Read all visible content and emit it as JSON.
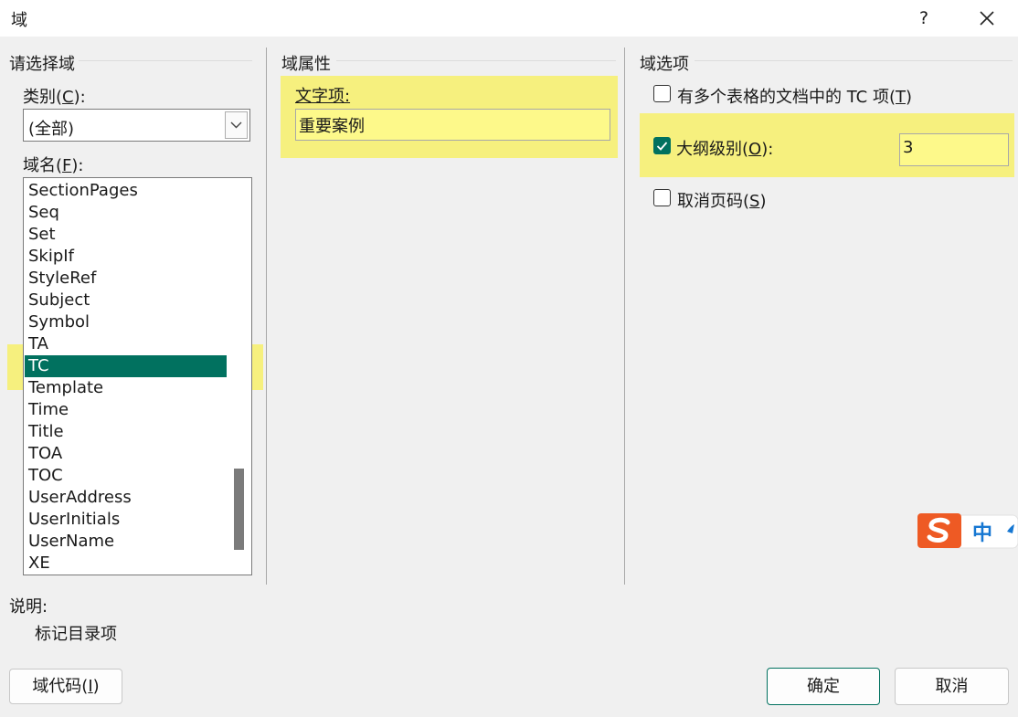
{
  "window": {
    "title": "域",
    "help": "?"
  },
  "left": {
    "group_title": "请选择域",
    "category": {
      "label_pre": "类别(",
      "label_key": "C",
      "label_post": "):",
      "value": "(全部)"
    },
    "fieldnames": {
      "label_pre": "域名(",
      "label_key": "F",
      "label_post": "):",
      "items": [
        "SectionPages",
        "Seq",
        "Set",
        "SkipIf",
        "StyleRef",
        "Subject",
        "Symbol",
        "TA",
        "TC",
        "Template",
        "Time",
        "Title",
        "TOA",
        "TOC",
        "UserAddress",
        "UserInitials",
        "UserName",
        "XE"
      ],
      "selected": "TC"
    }
  },
  "middle": {
    "group_title": "域属性",
    "text_entry": {
      "label": "文字项:",
      "value": "重要案例"
    }
  },
  "right": {
    "group_title": "域选项",
    "opt_multi_table": {
      "label_pre": "有多个表格的文档中的 TC 项(",
      "label_key": "T",
      "label_post": ")",
      "checked": false
    },
    "opt_outline": {
      "label_pre": "大纲级别(",
      "label_key": "O",
      "label_post": "):",
      "checked": true,
      "value": "3"
    },
    "opt_no_page": {
      "label_pre": "取消页码(",
      "label_key": "S",
      "label_post": ")",
      "checked": false
    }
  },
  "description": {
    "label": "说明:",
    "text": "标记目录项"
  },
  "buttons": {
    "field_codes_pre": "域代码(",
    "field_codes_key": "I",
    "field_codes_post": ")",
    "ok": "确定",
    "cancel": "取消"
  },
  "ime": {
    "char": "中"
  },
  "colors": {
    "accent": "#01715f",
    "highlight": "#f6f07e",
    "ime_orange": "#ee5a24",
    "ime_blue": "#1677d2"
  }
}
